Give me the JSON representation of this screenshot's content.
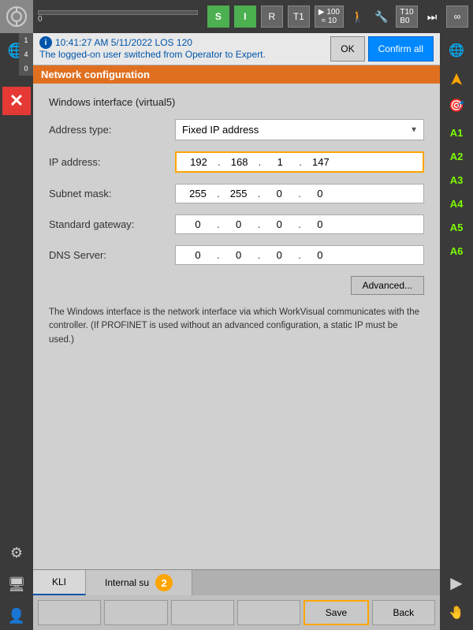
{
  "toolbar": {
    "progress_value": "0",
    "btn_s": "S",
    "btn_i": "I",
    "btn_r": "R",
    "btn_t1": "T1",
    "btn_speed": "100\n10",
    "btn_infinity": "∞"
  },
  "notification": {
    "time": "10:41:27 AM 5/11/2022 LOS 120",
    "message": "The logged-on user switched from Operator to Expert.",
    "ok_label": "OK",
    "confirm_all_label": "Confirm all"
  },
  "panel": {
    "title": "Network configuration",
    "section": "Windows interface (virtual5)",
    "address_type_label": "Address type:",
    "address_type_value": "Fixed IP address",
    "ip_address_label": "IP address:",
    "ip_octets": [
      "192",
      "168",
      "1",
      "147"
    ],
    "subnet_label": "Subnet mask:",
    "subnet_octets": [
      "255",
      "255",
      "0",
      "0"
    ],
    "gateway_label": "Standard gateway:",
    "gateway_octets": [
      "0",
      "0",
      "0",
      "0"
    ],
    "dns_label": "DNS Server:",
    "dns_octets": [
      "0",
      "0",
      "0",
      "0"
    ],
    "advanced_btn": "Advanced...",
    "info_text": "The Windows interface is the network interface via which WorkVisual communicates with the controller. (If PROFINET is used without an advanced configuration, a static IP must be used.)"
  },
  "sidebar_right": {
    "labels": [
      "A1",
      "A2",
      "A3",
      "A4",
      "A5",
      "A6"
    ]
  },
  "sidebar_left": {
    "numbers": [
      "1",
      "4",
      "0"
    ]
  },
  "tabs": {
    "tab1_label": "KLI",
    "tab2_label": "Internal su",
    "tab2_badge": "2"
  },
  "bottom_buttons": {
    "btn1": "",
    "btn2": "",
    "btn3": "",
    "btn4": "",
    "save_label": "Save",
    "back_label": "Back"
  }
}
